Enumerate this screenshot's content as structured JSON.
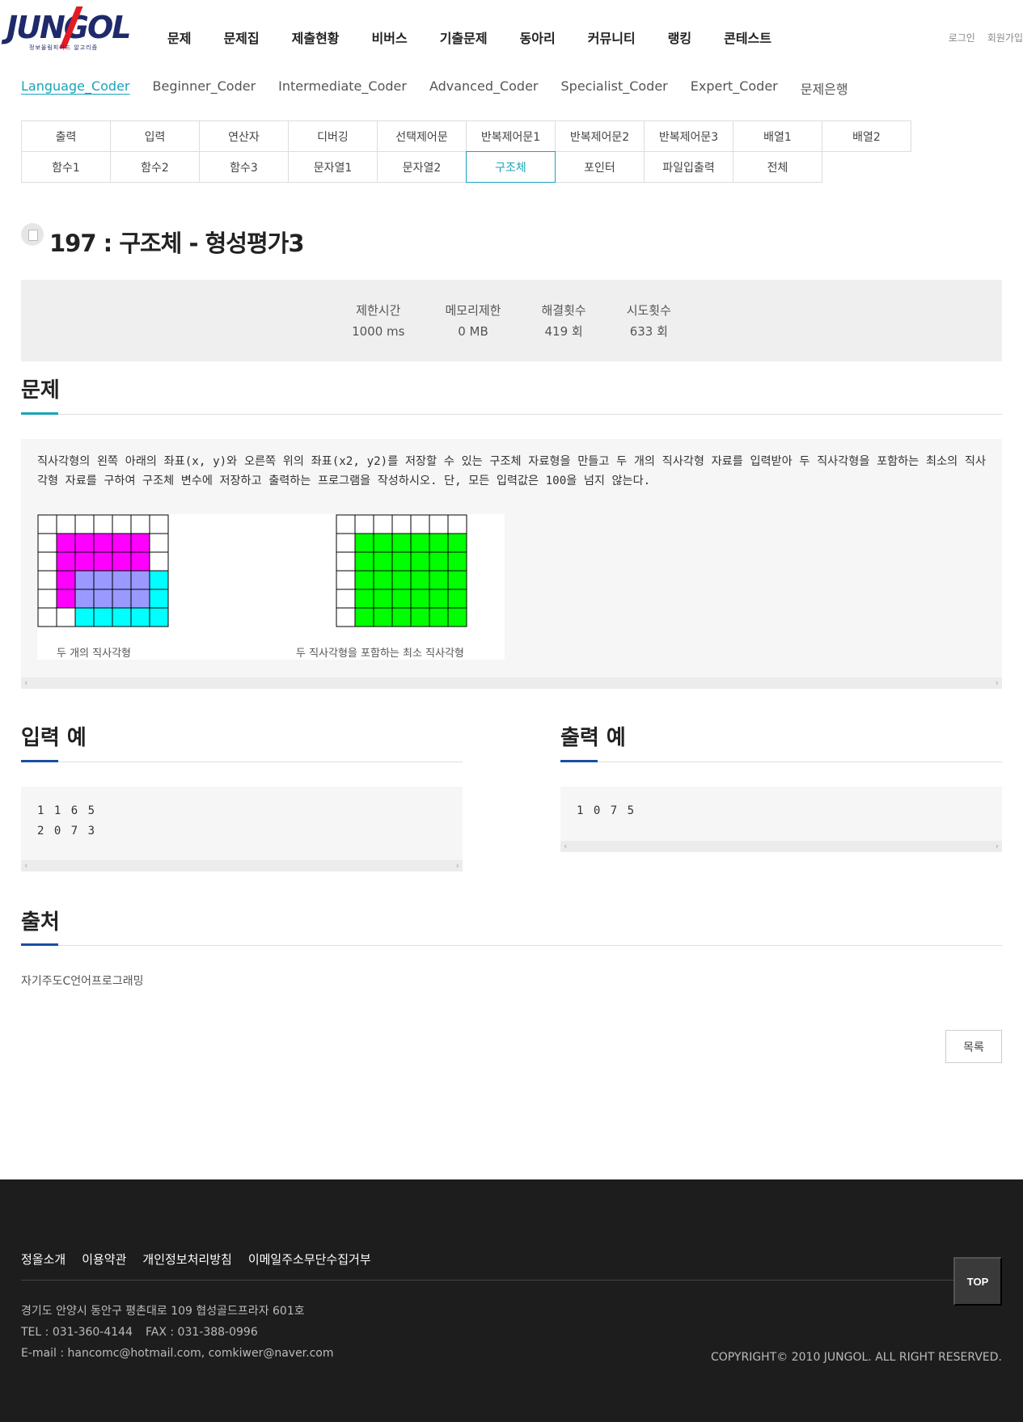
{
  "header": {
    "logo_text": "JUNGOL",
    "logo_sub": "정보올림피아드 알고리즘",
    "nav": [
      "문제",
      "문제집",
      "제출현황",
      "비버스",
      "기출문제",
      "동아리",
      "커뮤니티",
      "랭킹",
      "콘테스트"
    ],
    "login": "로그인",
    "signup": "회원가입"
  },
  "level_tabs": [
    "Language_Coder",
    "Beginner_Coder",
    "Intermediate_Coder",
    "Advanced_Coder",
    "Specialist_Coder",
    "Expert_Coder",
    "문제은행"
  ],
  "categories": {
    "row1": [
      "출력",
      "입력",
      "연산자",
      "디버깅",
      "선택제어문",
      "반복제어문1",
      "반복제어문2",
      "반복제어문3",
      "배열1",
      "배열2"
    ],
    "row2": [
      "함수1",
      "함수2",
      "함수3",
      "문자열1",
      "문자열2",
      "구조체",
      "포인터",
      "파일입출력",
      "전체"
    ],
    "active": "구조체"
  },
  "problem": {
    "title": "197 : 구조체 - 형성평가3",
    "stats": [
      {
        "label": "제한시간",
        "value": "1000 ms"
      },
      {
        "label": "메모리제한",
        "value": "0 MB"
      },
      {
        "label": "해결횟수",
        "value": "419 회"
      },
      {
        "label": "시도횟수",
        "value": "633 회"
      }
    ],
    "section_title": "문제",
    "description": "직사각형의 왼쪽 아래의 좌표(x, y)와 오른쪽 위의 좌표(x2, y2)를 저장할 수 있는 구조체 자료형을 만들고 두 개의 직사각형 자료를 입력받아 두 직사각형을 포함하는 최소의 직사각형 자료를 구하여 구조체 변수에 저장하고 출력하는 프로그램을 작성하시오. 단, 모든 입력값은 100을 넘지 않는다.",
    "caption_left": "두 개의 직사각형",
    "caption_right": "두 직사각형을 포함하는 최소 직사각형"
  },
  "input_example": {
    "title": "입력 예",
    "text": "1 1 6 5\n2 0 7 3"
  },
  "output_example": {
    "title": "출력 예",
    "text": "1 0 7 5"
  },
  "source": {
    "title": "출처",
    "text": "자기주도C언어프로그래밍"
  },
  "list_button": "목록",
  "footer": {
    "links": [
      "정올소개",
      "이용약관",
      "개인정보처리방침",
      "이메일주소무단수집거부"
    ],
    "address": "경기도 안양시 동안구 평촌대로 109 협성골드프라자 601호",
    "tel": "TEL : 031-360-4144",
    "fax": "FAX : 031-388-0996",
    "email": "E-mail : hancomc@hotmail.com, comkiwer@naver.com",
    "copyright": "COPYRIGHT© 2010 JUNGOL. ALL RIGHT RESERVED.",
    "top": "TOP"
  },
  "colors": {
    "accent": "#1aa4b8",
    "section_accent_teal": "#1aa4b8",
    "section_accent_blue": "#1a4fa0",
    "magenta": "#ff00ff",
    "overlap": "#9999ff",
    "cyan": "#00ffff",
    "green": "#00ff00"
  }
}
